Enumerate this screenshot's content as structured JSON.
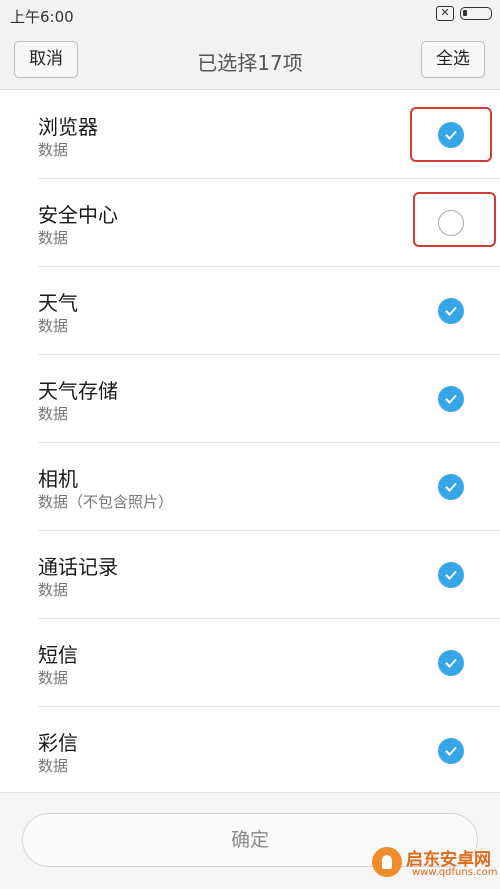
{
  "status_bar": {
    "time": "上午6:00",
    "close_icon_glyph": "✕"
  },
  "header": {
    "cancel_label": "取消",
    "title": "已选择17项",
    "select_all_label": "全选"
  },
  "items": [
    {
      "title": "浏览器",
      "subtitle": "数据",
      "checked": true
    },
    {
      "title": "安全中心",
      "subtitle": "数据",
      "checked": false
    },
    {
      "title": "天气",
      "subtitle": "数据",
      "checked": true
    },
    {
      "title": "天气存储",
      "subtitle": "数据",
      "checked": true
    },
    {
      "title": "相机",
      "subtitle": "数据（不包含照片）",
      "checked": true
    },
    {
      "title": "通话记录",
      "subtitle": "数据",
      "checked": true
    },
    {
      "title": "短信",
      "subtitle": "数据",
      "checked": true
    },
    {
      "title": "彩信",
      "subtitle": "数据",
      "checked": true
    }
  ],
  "confirm_label": "确定",
  "watermark": {
    "name": "启东安卓网",
    "url": "www.qdfuns.com"
  },
  "colors": {
    "accent": "#36a6e8",
    "highlight": "#d23a3a"
  }
}
